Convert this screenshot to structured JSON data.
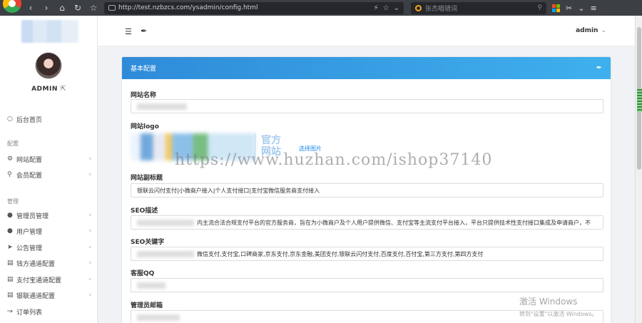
{
  "browser": {
    "url": "http://test.nzbzcs.com/ysadmin/config.html",
    "search_placeholder": "张杰唱错词"
  },
  "sidebar": {
    "username": "ADMIN",
    "items_top": [
      {
        "label": "后台首页",
        "icon": "home-icon"
      }
    ],
    "section_config": "配置",
    "items_config": [
      {
        "label": "网站配置",
        "icon": "gear-icon"
      },
      {
        "label": "会员配置",
        "icon": "key-icon"
      }
    ],
    "section_manage": "管理",
    "items_manage": [
      {
        "label": "管理员管理",
        "icon": "user-icon"
      },
      {
        "label": "用户管理",
        "icon": "users-icon"
      },
      {
        "label": "公告管理",
        "icon": "send-icon"
      },
      {
        "label": "钱方通道配置",
        "icon": "doc-icon"
      },
      {
        "label": "支付宝通道配置",
        "icon": "doc-icon"
      },
      {
        "label": "银联通道配置",
        "icon": "doc-icon"
      },
      {
        "label": "订单列表",
        "icon": "chart-icon"
      }
    ]
  },
  "header": {
    "admin_label": "admin"
  },
  "card": {
    "title": "基本配置",
    "fields": {
      "site_name_label": "网站名称",
      "site_logo_label": "网站logo",
      "logo_text": "官方\n网站",
      "choose_image": "选择图片",
      "subtitle_label": "网站副标题",
      "subtitle_value": "银联云闪付支付|小微商户接入|个人支付接口|支付宝微信服务商支付接入",
      "seo_desc_label": "SEO描述",
      "seo_desc_value": "内主流合法合规支付平台的官方服务商，旨在为小微商户及个人用户提供微信、支付宝等主流支付平台接入，平台只提供技术性支付接口集成及申请商户，不",
      "seo_keywords_label": "SEO关键字",
      "seo_keywords_value": "微信支付,支付宝,口碑商家,京东支付,京东金融,美团支付,银联云闪付支付,百度支付,百付宝,第三方支付,第四方支付",
      "qq_label": "客服QQ",
      "admin_email_label": "管理员邮箱"
    }
  },
  "overlay": {
    "watermark": "https://www.huzhan.com/ishop37140",
    "activate_title": "激活 Windows",
    "activate_sub": "转到\"设置\"以激活 Windows。"
  }
}
